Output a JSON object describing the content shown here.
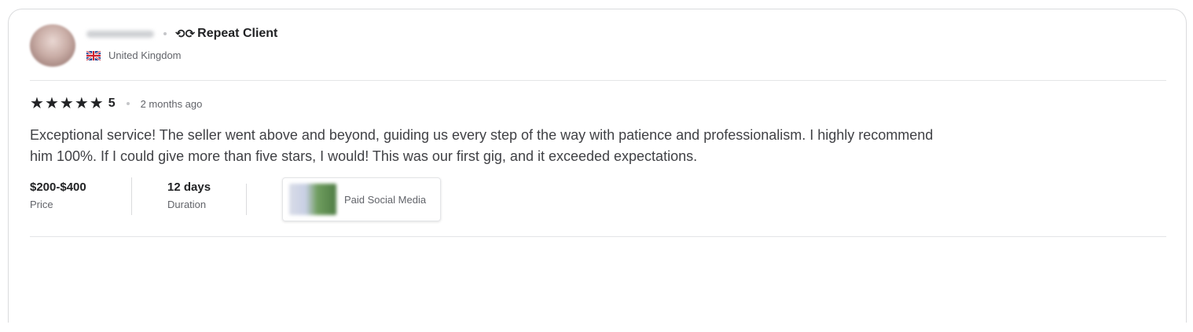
{
  "reviewer": {
    "name": "",
    "badge_icon": "repeat-icon",
    "badge_label": "Repeat Client",
    "country": "United Kingdom",
    "flag_icon": "uk-flag-icon"
  },
  "rating": {
    "stars": 5,
    "value": "5",
    "time_ago": "2 months ago"
  },
  "review": {
    "text": "Exceptional service! The seller went above and beyond, guiding us every step of the way with patience and professionalism. I highly recommend him 100%. If I could give more than five stars, I would! This was our first gig, and it exceeded expectations."
  },
  "meta": {
    "price_value": "$200-$400",
    "price_label": "Price",
    "duration_value": "12 days",
    "duration_label": "Duration"
  },
  "gig": {
    "title": "Paid Social Media"
  },
  "colors": {
    "text_primary": "#222325",
    "text_secondary": "#62646a",
    "border": "#dadbdd"
  }
}
